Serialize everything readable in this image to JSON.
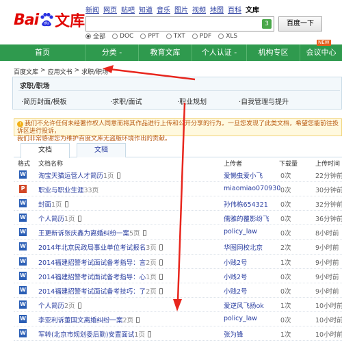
{
  "topnav": [
    "新闻",
    "网页",
    "贴吧",
    "知道",
    "音乐",
    "图片",
    "视频",
    "地图",
    "百科",
    "文库"
  ],
  "logo": {
    "bai": "Bai",
    "du": "du",
    "wenku": "文库"
  },
  "search": {
    "value": "",
    "badge": "3",
    "button": "百度一下",
    "right_cut": "",
    "right_cut2": ""
  },
  "filetypes": [
    {
      "label": "全部",
      "checked": true
    },
    {
      "label": "DOC",
      "checked": false
    },
    {
      "label": "PPT",
      "checked": false
    },
    {
      "label": "TXT",
      "checked": false
    },
    {
      "label": "PDF",
      "checked": false
    },
    {
      "label": "XLS",
      "checked": false
    }
  ],
  "mainnav": [
    "首页",
    "分类 -",
    "教育文库",
    "个人认证 -",
    "机构专区",
    "会议中心"
  ],
  "new_badge": "NEW",
  "breadcrumb": [
    "百度文库",
    ">",
    "应用文书",
    ">",
    "求职/职场"
  ],
  "category": {
    "title": "求职/职场",
    "subs": [
      "·简历封面/模板",
      "·求职/面试",
      "·职业规划",
      "·自我管理与提升"
    ]
  },
  "notice": {
    "line1": "我们不允许任何未经著作权人同意而将其作品进行上传和公开分享的行为。一旦您发现了此类文档，希望您能前往投诉区进行投诉，",
    "line2": "我们非常感谢您为维护百度文库无盗版环境作出的贡献。"
  },
  "tabs": [
    "文档",
    "文辑"
  ],
  "table_headers": {
    "format": "格式",
    "name": "文档名称",
    "uploader": "上传者",
    "downloads": "下载量",
    "time": "上传时间"
  },
  "rows": [
    {
      "type": "W",
      "title": "淘宝天猫运营人才简历",
      "pages": "1页",
      "phone": true,
      "uploader": "爱懒虫爱小飞",
      "dl": "0次",
      "time": "22分钟前"
    },
    {
      "type": "P",
      "title": "职业与职业生涯",
      "pages": "33页",
      "phone": false,
      "uploader": "miaomiao070930",
      "dl": "0次",
      "time": "30分钟前"
    },
    {
      "type": "W",
      "title": "封面",
      "pages": "1页",
      "phone": true,
      "uploader": "孙伟栋654321",
      "dl": "0次",
      "time": "32分钟前"
    },
    {
      "type": "W",
      "title": "个人简历",
      "pages": "1页",
      "phone": true,
      "uploader": "儒雅的覆影纷飞",
      "dl": "0次",
      "time": "36分钟前"
    },
    {
      "type": "W",
      "title": "王更新诉张庆鑫为离婚纠纷一案",
      "pages": "5页",
      "phone": true,
      "uploader": "policy_law",
      "dl": "0次",
      "time": "8小时前"
    },
    {
      "type": "W",
      "title": "2014年北京民政局事业单位考试报名",
      "pages": "3页",
      "phone": true,
      "uploader": "华图网校北京",
      "dl": "2次",
      "time": "9小时前"
    },
    {
      "type": "W",
      "title": "2014福建招警考试面试备考指导：言",
      "pages": "2页",
      "phone": true,
      "uploader": "小贱2号",
      "dl": "1次",
      "time": "9小时前"
    },
    {
      "type": "W",
      "title": "2014福建招警考试面试备考指导：心",
      "pages": "1页",
      "phone": true,
      "uploader": "小贱2号",
      "dl": "0次",
      "time": "9小时前"
    },
    {
      "type": "W",
      "title": "2014福建招警考试面试备考技巧：了",
      "pages": "2页",
      "phone": true,
      "uploader": "小贱2号",
      "dl": "0次",
      "time": "9小时前"
    },
    {
      "type": "W",
      "title": "个人简历",
      "pages": "2页",
      "phone": true,
      "uploader": "爱逆风飞扬ok",
      "dl": "1次",
      "time": "10小时前"
    },
    {
      "type": "W",
      "title": "李亚利诉董国文离婚纠纷一案",
      "pages": "2页",
      "phone": true,
      "uploader": "policy_law",
      "dl": "0次",
      "time": "10小时前"
    },
    {
      "type": "W",
      "title": "军转(北京市规划委后勤)安置面试",
      "pages": "1页",
      "phone": true,
      "uploader": "张为锋",
      "dl": "1次",
      "time": "10小时前"
    }
  ],
  "colors": {
    "green": "#2f9a4e",
    "link": "#2a3ea0",
    "red": "#e10602"
  }
}
